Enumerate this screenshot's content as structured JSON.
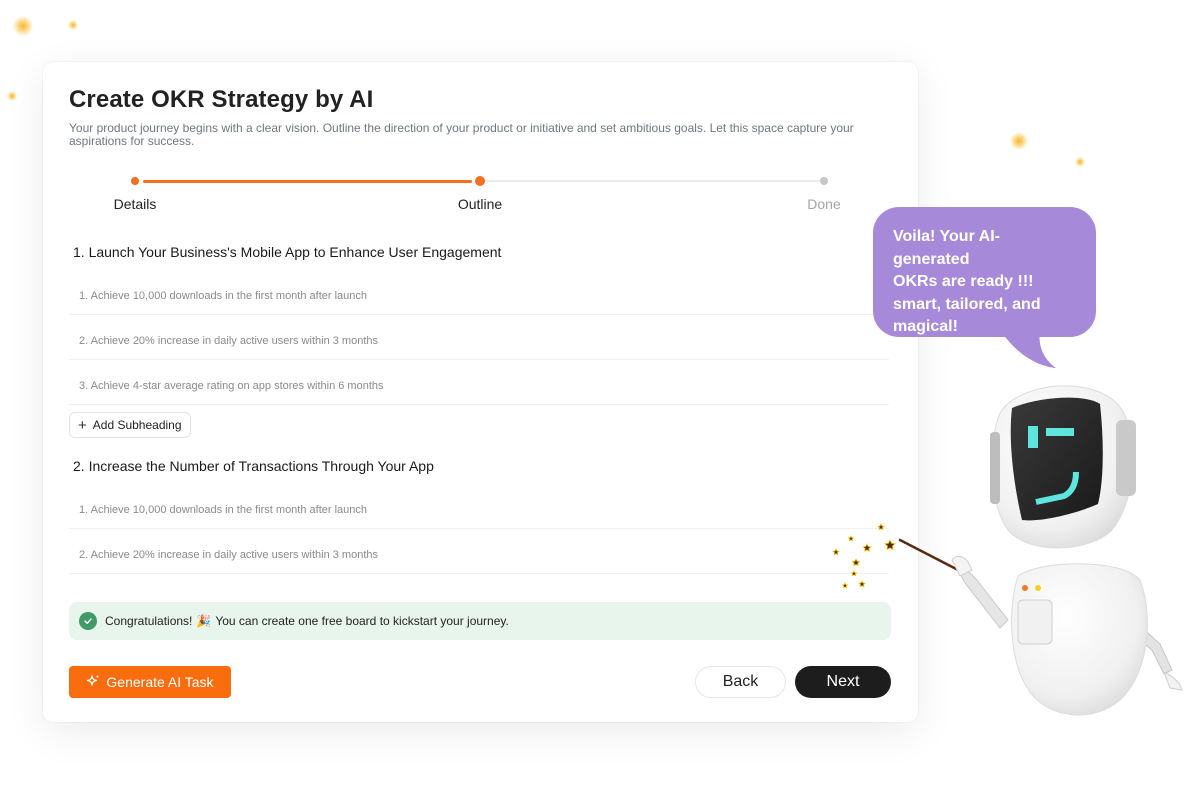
{
  "page": {
    "title": "Create OKR Strategy by AI",
    "subtitle": "Your product journey begins with a clear vision. Outline the direction of your product or initiative and set ambitious goals. Let this space capture your aspirations for success."
  },
  "stepper": {
    "steps": [
      {
        "label": "Details",
        "state": "completed"
      },
      {
        "label": "Outline",
        "state": "current"
      },
      {
        "label": "Done",
        "state": "pending"
      }
    ]
  },
  "objectives": [
    {
      "title": "1. Launch Your Business's Mobile App to Enhance User Engagement",
      "key_results": [
        "1. Achieve 10,000 downloads in the first month after launch",
        "2. Achieve 20% increase in daily active users within 3 months",
        "3. Achieve 4-star average rating on app stores within 6 months"
      ]
    },
    {
      "title": "2. Increase the Number of Transactions Through Your App",
      "key_results": [
        "1. Achieve 10,000 downloads in the first month after launch",
        "2. Achieve 20% increase in daily active users within 3 months"
      ]
    }
  ],
  "add_subheading": {
    "label": "Add Subheading",
    "icon": "plus-icon"
  },
  "alert": {
    "text_before": "Congratulations!",
    "emoji": "🎉",
    "text_after": "You can create one free board to kickstart your journey.",
    "icon": "check-circle-icon"
  },
  "footer": {
    "generate_label": "Generate AI Task",
    "generate_icon": "sparkle-icon",
    "back_label": "Back",
    "next_label": "Next"
  },
  "speech_bubble": {
    "lines": [
      "Voila! Your AI-generated",
      "OKRs are ready !!!",
      "smart, tailored, and",
      "magical!"
    ]
  },
  "colors": {
    "accent": "#fa6d0f",
    "progress": "#f37021",
    "bubble": "#a68ad9",
    "success_bg": "#e8f5ec",
    "success_icon": "#3f9a65",
    "primary_dark": "#1d1d1d"
  }
}
